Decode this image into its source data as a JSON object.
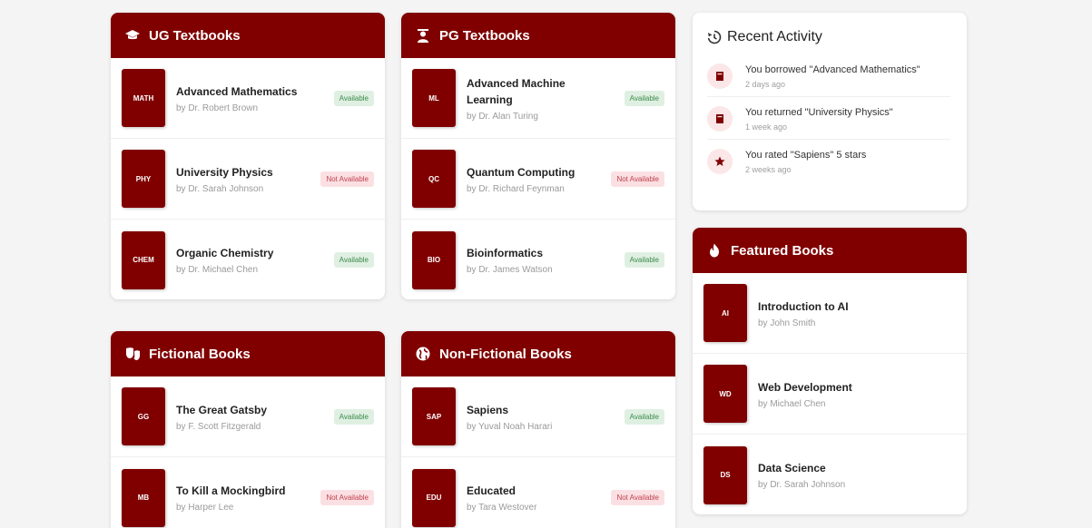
{
  "ug": {
    "title": "UG Textbooks",
    "books": [
      {
        "code": "MATH",
        "title": "Advanced Mathematics",
        "author": "by Dr. Robert Brown",
        "status": "Available"
      },
      {
        "code": "PHY",
        "title": "University Physics",
        "author": "by Dr. Sarah Johnson",
        "status": "Not Available"
      },
      {
        "code": "CHEM",
        "title": "Organic Chemistry",
        "author": "by Dr. Michael Chen",
        "status": "Available"
      }
    ]
  },
  "pg": {
    "title": "PG Textbooks",
    "books": [
      {
        "code": "ML",
        "title": "Advanced Machine Learning",
        "author": "by Dr. Alan Turing",
        "status": "Available"
      },
      {
        "code": "QC",
        "title": "Quantum Computing",
        "author": "by Dr. Richard Feynman",
        "status": "Not Available"
      },
      {
        "code": "BIO",
        "title": "Bioinformatics",
        "author": "by Dr. James Watson",
        "status": "Available"
      }
    ]
  },
  "fiction": {
    "title": "Fictional Books",
    "books": [
      {
        "code": "GG",
        "title": "The Great Gatsby",
        "author": "by F. Scott Fitzgerald",
        "status": "Available"
      },
      {
        "code": "MB",
        "title": "To Kill a Mockingbird",
        "author": "by Harper Lee",
        "status": "Not Available"
      }
    ]
  },
  "nonfiction": {
    "title": "Non-Fictional Books",
    "books": [
      {
        "code": "SAP",
        "title": "Sapiens",
        "author": "by Yuval Noah Harari",
        "status": "Available"
      },
      {
        "code": "EDU",
        "title": "Educated",
        "author": "by Tara Westover",
        "status": "Not Available"
      }
    ]
  },
  "activity": {
    "title": "Recent Activity",
    "items": [
      {
        "icon": "book-icon",
        "text": "You borrowed \"Advanced Mathematics\"",
        "time": "2 days ago"
      },
      {
        "icon": "book-icon",
        "text": "You returned \"University Physics\"",
        "time": "1 week ago"
      },
      {
        "icon": "star-icon",
        "text": "You rated \"Sapiens\" 5 stars",
        "time": "2 weeks ago"
      }
    ]
  },
  "featured": {
    "title": "Featured Books",
    "books": [
      {
        "code": "AI",
        "title": "Introduction to AI",
        "author": "by John Smith"
      },
      {
        "code": "WD",
        "title": "Web Development",
        "author": "by Michael Chen"
      },
      {
        "code": "DS",
        "title": "Data Science",
        "author": "by Dr. Sarah Johnson"
      }
    ]
  },
  "colors": {
    "accent": "#800000",
    "available_bg": "#dff0e2",
    "unavailable_bg": "#fbe0e3"
  }
}
